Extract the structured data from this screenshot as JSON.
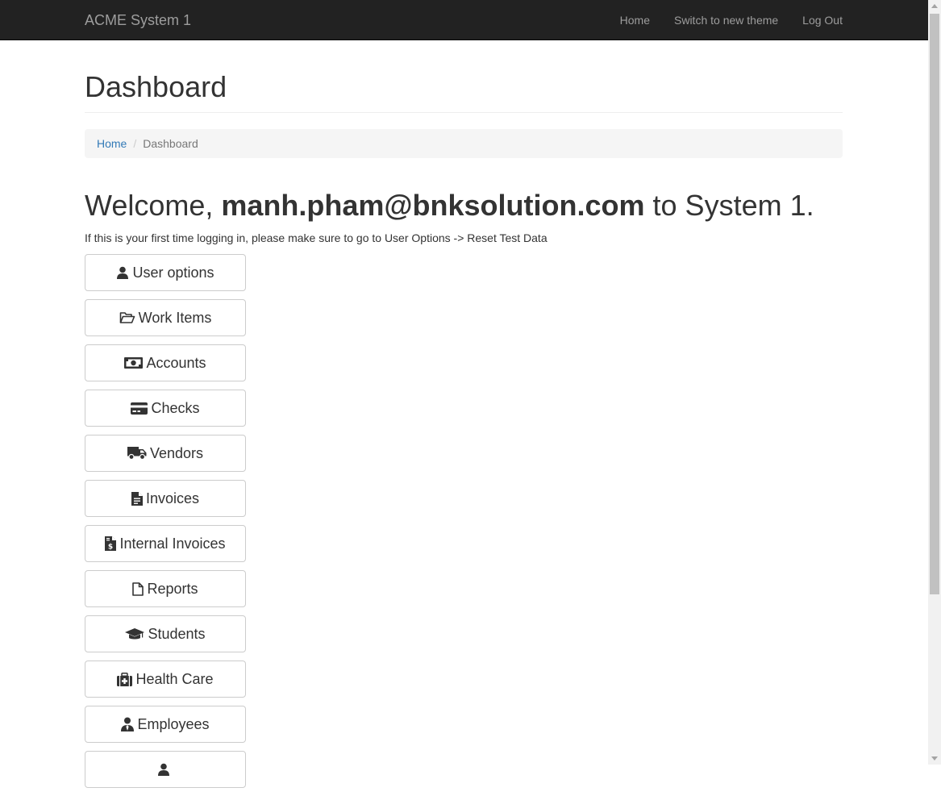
{
  "navbar": {
    "brand": "ACME System 1",
    "links": [
      "Home",
      "Switch to new theme",
      "Log Out"
    ]
  },
  "page": {
    "title": "Dashboard"
  },
  "breadcrumb": {
    "home": "Home",
    "separator": "/",
    "current": "Dashboard"
  },
  "welcome": {
    "prefix": "Welcome, ",
    "user": "manh.pham@bnksolution.com",
    "suffix": " to System 1."
  },
  "hint": "If this is your first time logging in, please make sure to go to User Options -> Reset Test Data",
  "menu": [
    {
      "label": "User options",
      "icon": "user-icon"
    },
    {
      "label": "Work Items",
      "icon": "folder-open-icon"
    },
    {
      "label": "Accounts",
      "icon": "money-icon"
    },
    {
      "label": "Checks",
      "icon": "credit-card-icon"
    },
    {
      "label": "Vendors",
      "icon": "truck-icon"
    },
    {
      "label": "Invoices",
      "icon": "file-text-icon"
    },
    {
      "label": "Internal Invoices",
      "icon": "file-invoice-dollar-icon"
    },
    {
      "label": "Reports",
      "icon": "file-icon"
    },
    {
      "label": "Students",
      "icon": "graduation-cap-icon"
    },
    {
      "label": "Health Care",
      "icon": "medkit-icon"
    },
    {
      "label": "Employees",
      "icon": "user-tie-icon"
    },
    {
      "label": "",
      "icon": "user-icon"
    }
  ]
}
